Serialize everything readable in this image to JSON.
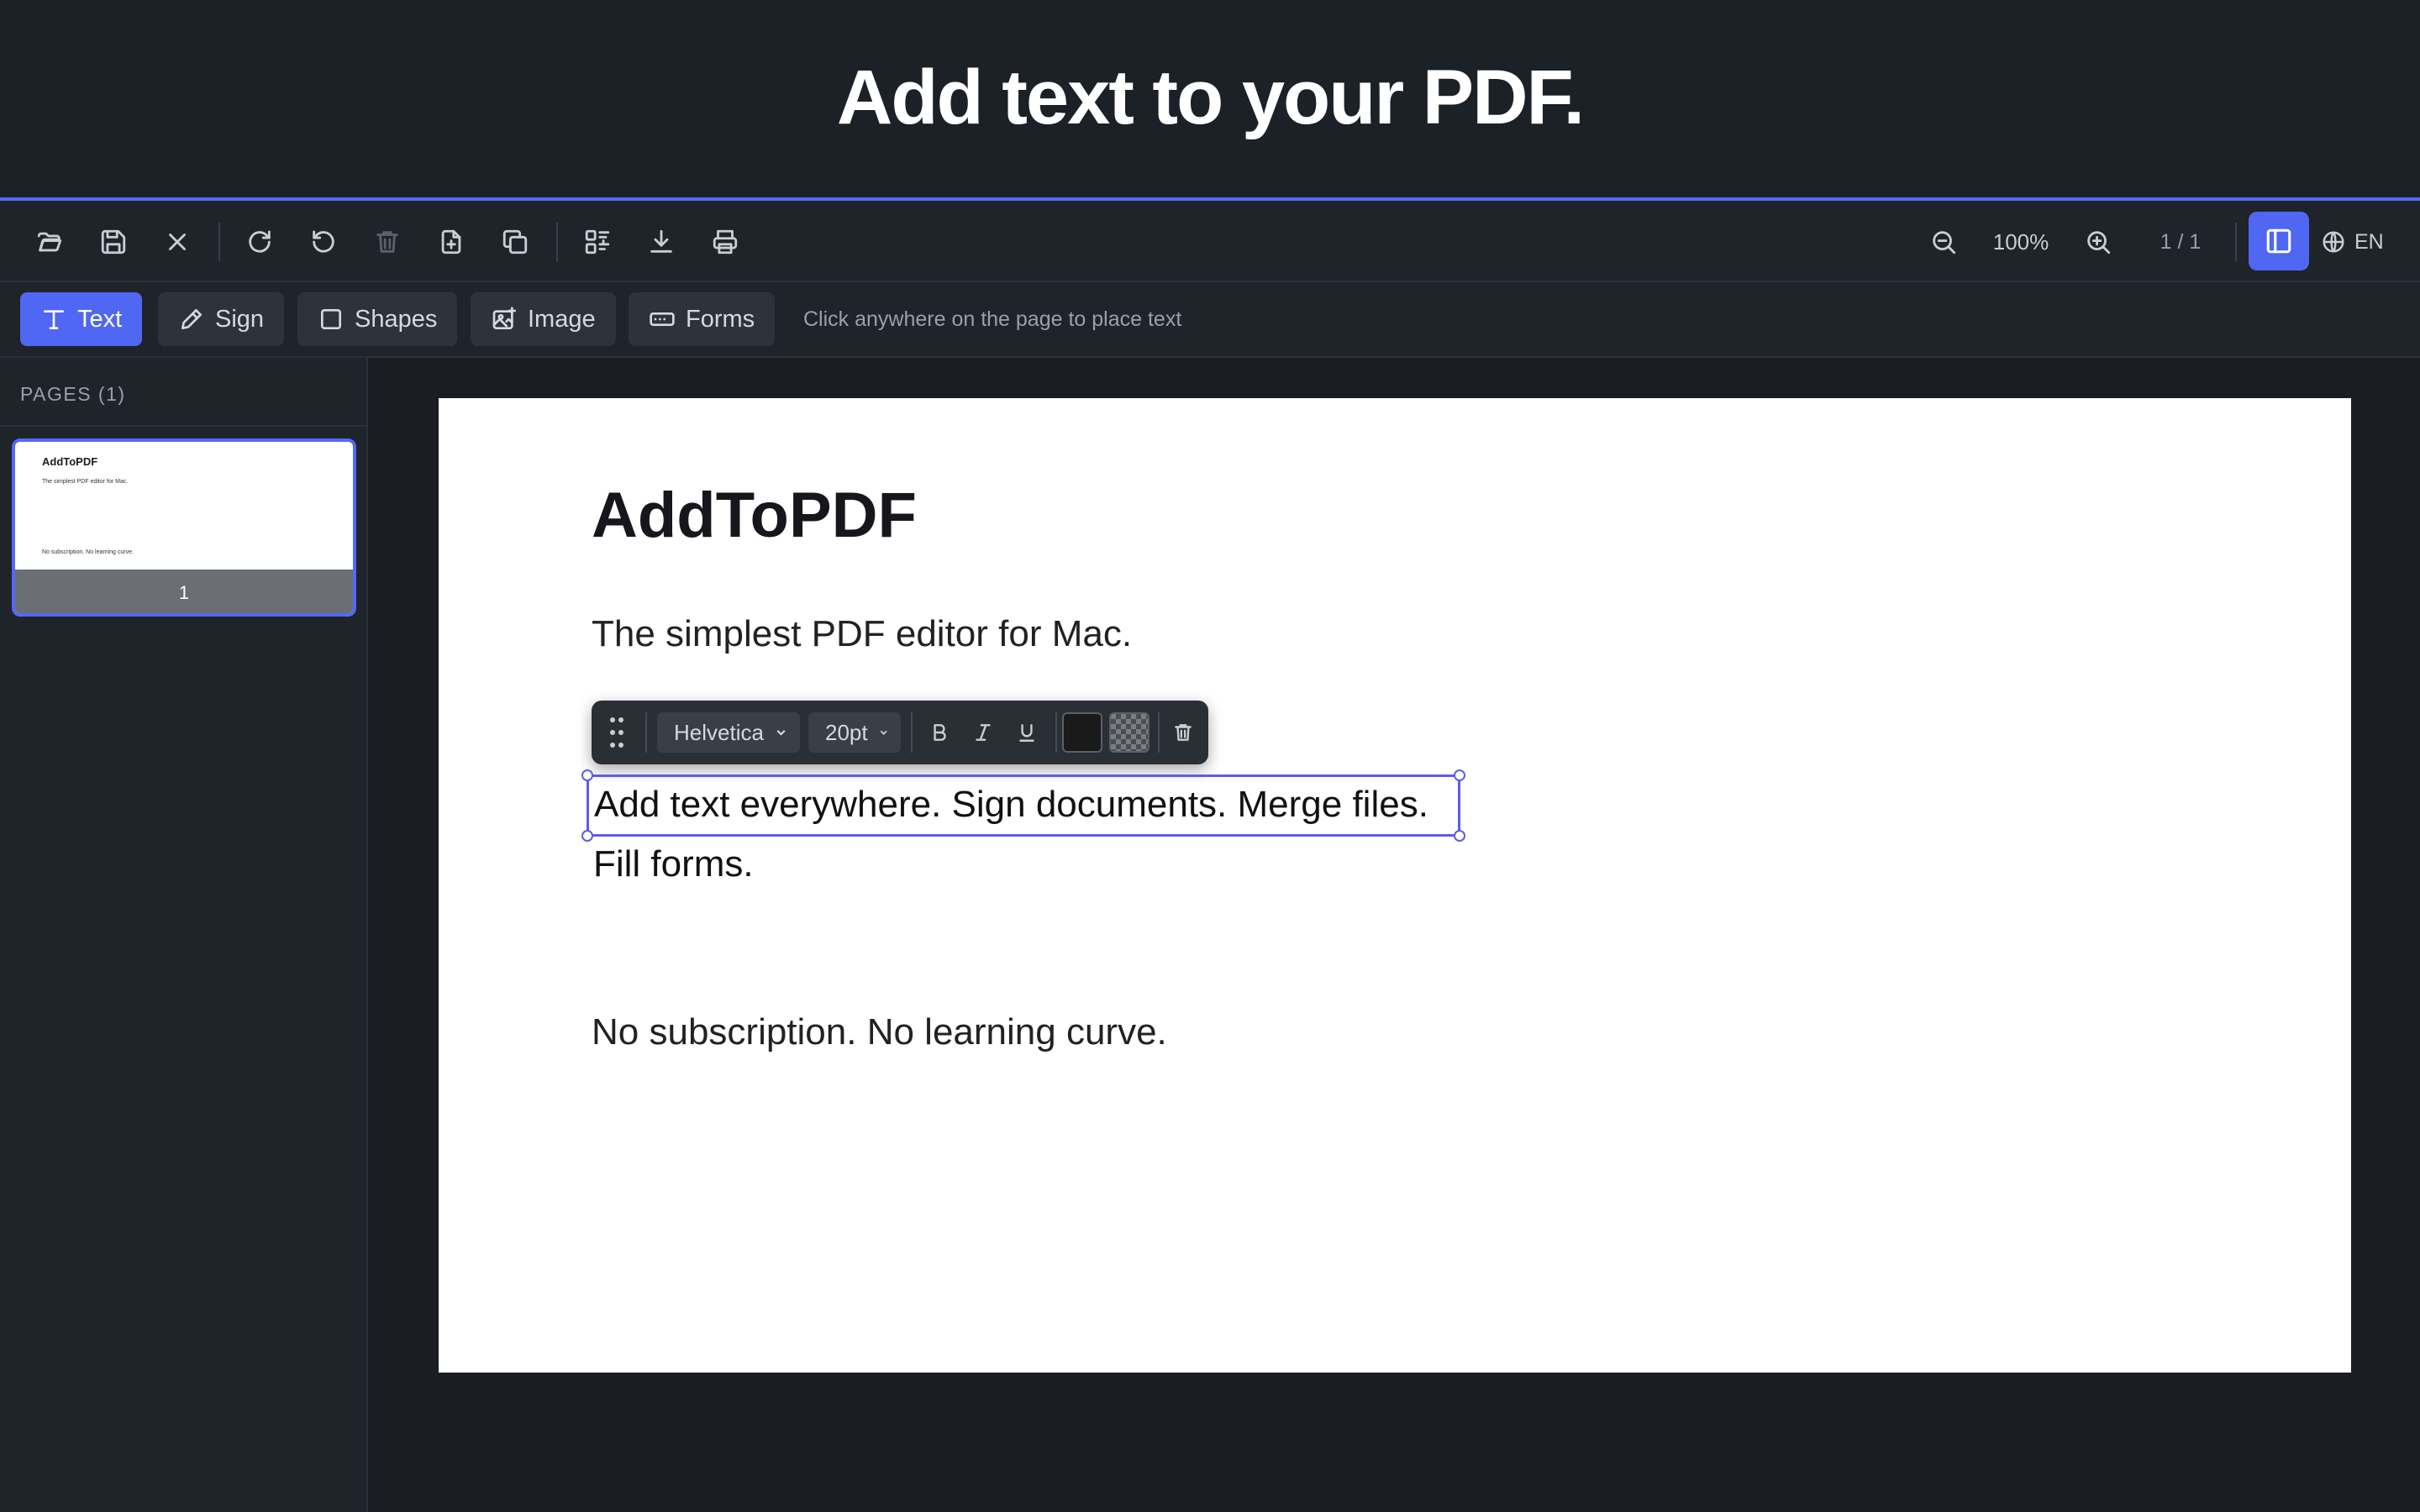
{
  "hero": {
    "title": "Add text to your PDF."
  },
  "toolbar": {
    "zoom": "100%",
    "page_indicator": "1 / 1",
    "language": "EN"
  },
  "modes": [
    {
      "label": "Text",
      "icon": "text-icon",
      "active": true
    },
    {
      "label": "Sign",
      "icon": "pen-icon",
      "active": false
    },
    {
      "label": "Shapes",
      "icon": "square-icon",
      "active": false
    },
    {
      "label": "Image",
      "icon": "image-icon",
      "active": false
    },
    {
      "label": "Forms",
      "icon": "form-field-icon",
      "active": false
    }
  ],
  "hint": "Click anywhere on the page to place text",
  "sidebar": {
    "title": "PAGES (1)",
    "thumbnails": [
      {
        "label": "1",
        "title": "AddToPDF",
        "subtitle": "The simplest PDF editor for Mac.",
        "footer": "No subscription. No learning curve."
      }
    ]
  },
  "document": {
    "title": "AddToPDF",
    "subtitle": "The simplest PDF editor for Mac.",
    "selected_text_line1": "Add text everywhere. Sign documents. Merge files.",
    "selected_text_line2": "Fill forms.",
    "footer": "No subscription. No learning curve."
  },
  "format_toolbar": {
    "font": "Helvetica",
    "size": "20pt",
    "text_color": "#1a1a1a",
    "background": "transparent"
  },
  "colors": {
    "accent": "#4f67f2",
    "selection": "#5b5ee6",
    "background": "#1a1d23"
  }
}
